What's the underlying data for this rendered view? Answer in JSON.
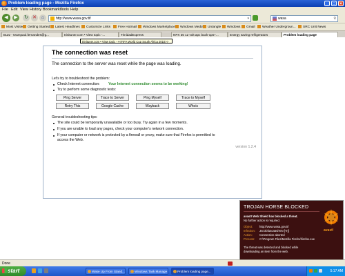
{
  "window": {
    "title": "Problem loading page - Mozilla Firefox"
  },
  "menu": [
    "File",
    "Edit",
    "View",
    "History",
    "Bookmarks",
    "Tools",
    "Help"
  ],
  "nav": {
    "url": "http://www.wasa.gov.tt/",
    "search_value": "wasa"
  },
  "bookmarks": [
    "Most Visited",
    "Getting Started",
    "Latest Headlines",
    "Customize Links",
    "Free Hotmail",
    "Windows Marketplace",
    "Windows Media",
    "Untangle",
    "Windows",
    "Gmail",
    "Weather Undergroun...",
    "SRC Unit News"
  ],
  "tabs": [
    "Buzz - teampaul.fernandes@g...",
    "trinituner.com • View topic -...",
    "TrinidadExpress",
    "NPX 35 12 volt apc back-ups+...",
    "Energy saving refrigerators",
    "Problem loading page"
  ],
  "tooltip": "trinituner.com • View topic - <<FIFA World Cup South Africa 2010>>",
  "error": {
    "title": "The connection was reset",
    "subtitle": "The connection to the server was reset while the page was loading.",
    "troubleshoot_intro": "Let's try to troubleshoot the problem:",
    "check_label": "Check Internet connection:",
    "check_result": "Your Internet connection seems to be working!",
    "try_tests": "Try to perform some diagnostic tests:",
    "buttons": [
      "Ping Server",
      "Trace to Server",
      "Ping Myself",
      "Trace to Myself",
      "Retry This",
      "Google Cache",
      "Wayback",
      "Whois"
    ],
    "general_tips": "General troubleshooting tips:",
    "tips": [
      "The site could be temporarily unavailable or too busy. Try again in a few moments.",
      "If you are unable to load any pages, check your computer's network connection.",
      "If your computer or network is protected by a firewall or proxy, make sure that Firefox is permitted to",
      "access the Web."
    ],
    "version": "version 1.2.4"
  },
  "status": "Done",
  "avast": {
    "header": "TROJAN HORSE BLOCKED",
    "msg1": "avast! Web Shield has blocked a threat.",
    "msg2": "No further action is required.",
    "object_label": "Object:",
    "object_value": "http://www.wasa.gov.tt/",
    "infection_label": "Infection:",
    "infection_value": "JS:Obfuscated-EN [Trj]",
    "action_label": "Action:",
    "action_value": "Connection aborted",
    "process_label": "Process:",
    "process_value": "C:\\Program Files\\Mozilla Firefox\\firefox.exe",
    "footer1": "The threat was detected and blocked while",
    "footer2": "downloading an item from the web.",
    "brand": "avast!"
  },
  "taskbar": {
    "start": "start",
    "tasks": [
      "Wake Up From Stand...",
      "Windows Task Manage",
      "Problem loading page..."
    ],
    "clock": "5:17 AM"
  }
}
